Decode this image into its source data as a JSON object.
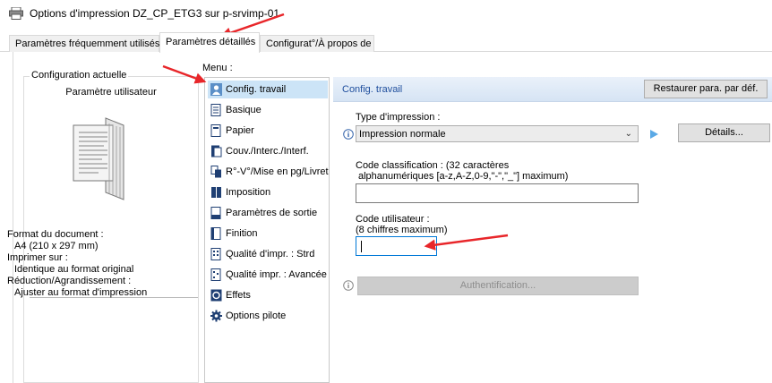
{
  "window": {
    "title": "Options d'impression DZ_CP_ETG3 sur p-srvimp-01",
    "icon": "printer-icon"
  },
  "tabs": [
    {
      "label": "Paramètres fréquemment utilisés",
      "active": false
    },
    {
      "label": "Paramètres détaillés",
      "active": true
    },
    {
      "label": "Configurat°/À propos de",
      "active": false
    }
  ],
  "current_config": {
    "legend": "Configuration actuelle",
    "subtitle": "Paramètre utilisateur",
    "format_label": "Format du document :",
    "format_value": "A4 (210 x 297 mm)",
    "print_on_label": "Imprimer sur :",
    "print_on_value": "Identique au format original",
    "scale_label": "Réduction/Agrandissement :",
    "scale_value": "Ajuster au format d'impression"
  },
  "menu": {
    "label": "Menu :",
    "items": [
      {
        "label": "Config. travail",
        "icon": "user-icon",
        "selected": true
      },
      {
        "label": "Basique",
        "icon": "document-icon"
      },
      {
        "label": "Papier",
        "icon": "paper-icon"
      },
      {
        "label": "Couv./Interc./Interf.",
        "icon": "cover-icon"
      },
      {
        "label": "R°-V°/Mise en pg/Livret",
        "icon": "duplex-icon"
      },
      {
        "label": "Imposition",
        "icon": "imposition-icon"
      },
      {
        "label": "Paramètres de sortie",
        "icon": "output-icon"
      },
      {
        "label": "Finition",
        "icon": "finishing-icon"
      },
      {
        "label": "Qualité d'impr. : Strd",
        "icon": "quality-icon"
      },
      {
        "label": "Qualité impr. : Avancée",
        "icon": "quality-advanced-icon"
      },
      {
        "label": "Effets",
        "icon": "effects-icon"
      },
      {
        "label": "Options pilote",
        "icon": "gear-icon"
      }
    ]
  },
  "job_config": {
    "header_title": "Config. travail",
    "restore_button": "Restaurer para. par déf.",
    "print_type_label": "Type d'impression :",
    "print_type_value": "Impression normale",
    "details_button": "Détails...",
    "classification_label_1": "Code classification : (32 caractères",
    "classification_label_2": "alphanumériques [a-z,A-Z,0-9,\"-\",\"_\"] maximum)",
    "classification_value": "",
    "user_code_label_1": "Code utilisateur :",
    "user_code_label_2": "(8 chiffres maximum)",
    "user_code_value": "",
    "auth_button": "Authentification..."
  },
  "colors": {
    "annotation_arrow": "#e8262a",
    "selected_bg": "#cce4f7",
    "header_text": "#1f4e9d"
  }
}
